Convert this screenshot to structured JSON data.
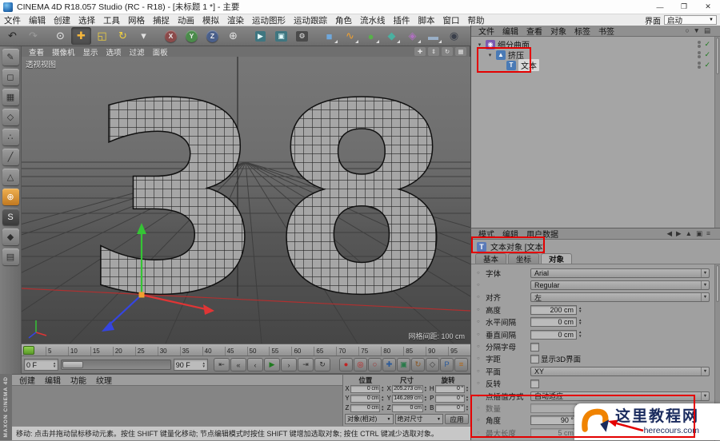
{
  "window": {
    "title": "CINEMA 4D R18.057 Studio (RC - R18) - [未标题 1 *] - 主要",
    "controls": [
      {
        "name": "minimize-button",
        "glyph": "—"
      },
      {
        "name": "maximize-button",
        "glyph": "❐"
      },
      {
        "name": "close-button",
        "glyph": "✕"
      }
    ]
  },
  "menu_bar": {
    "items": [
      "文件",
      "编辑",
      "创建",
      "选择",
      "工具",
      "网格",
      "捕捉",
      "动画",
      "模拟",
      "渲染",
      "运动图形",
      "运动跟踪",
      "角色",
      "流水线",
      "插件",
      "脚本",
      "窗口",
      "帮助"
    ],
    "interface_label": "界面",
    "interface_value": "启动"
  },
  "toolbar": {
    "icons": [
      {
        "name": "undo-icon",
        "glyph": "↶",
        "fg": "#222222"
      },
      {
        "name": "redo-icon",
        "glyph": "↷",
        "fg": "#9b9b9b"
      },
      {
        "sep": true
      },
      {
        "name": "live-selection-icon",
        "glyph": "⊙",
        "fg": "#e8e8e8"
      },
      {
        "name": "move-tool-icon",
        "glyph": "✚",
        "fg": "#f6b73c",
        "active": true
      },
      {
        "name": "scale-tool-icon",
        "glyph": "◱",
        "fg": "#f1d13f"
      },
      {
        "name": "rotate-tool-icon",
        "glyph": "↻",
        "fg": "#f1d13f"
      },
      {
        "name": "recent-tools-icon",
        "glyph": "▾",
        "fg": "#e0e0e0"
      },
      {
        "sep": true
      },
      {
        "name": "x-axis-lock",
        "glyph": "X",
        "circle": "#8a4a4a"
      },
      {
        "name": "y-axis-lock",
        "glyph": "Y",
        "circle": "#4a8a4a"
      },
      {
        "name": "z-axis-lock",
        "glyph": "Z",
        "circle": "#4a5f8a"
      },
      {
        "name": "coordinate-system-icon",
        "glyph": "⊕",
        "fg": "#e0e0e0"
      },
      {
        "sep": true
      },
      {
        "name": "render-view-icon",
        "glyph": "▶",
        "chip": "#3f7680",
        "fg": "#e8ffff"
      },
      {
        "name": "render-picture-viewer-icon",
        "glyph": "▣",
        "chip": "#3f7680",
        "fg": "#e8ffff"
      },
      {
        "name": "render-settings-icon",
        "glyph": "⚙",
        "chip": "#4a4a4a",
        "fg": "#e8e8e8"
      },
      {
        "sep": true
      },
      {
        "name": "primitive-cube-icon",
        "glyph": "■",
        "fg": "#6fa8dc",
        "corner": true
      },
      {
        "name": "spline-pen-icon",
        "glyph": "∿",
        "fg": "#f0a030",
        "corner": true
      },
      {
        "name": "subdivision-surface-icon",
        "glyph": "●",
        "fg": "#57b04a",
        "corner": true
      },
      {
        "name": "generator-icon",
        "glyph": "◆",
        "fg": "#4ab0a0",
        "corner": true
      },
      {
        "name": "deformer-icon",
        "glyph": "◈",
        "fg": "#b070c0",
        "corner": true
      },
      {
        "name": "environment-icon",
        "glyph": "▬",
        "fg": "#9ab0c8",
        "corner": true
      },
      {
        "name": "camera-icon",
        "glyph": "◉",
        "fg": "#3a3f4a"
      },
      {
        "name": "light-icon",
        "glyph": "☀",
        "fg": "#f1d13f"
      }
    ]
  },
  "left_toolbar": {
    "icons": [
      {
        "name": "make-editable-icon",
        "glyph": "✎"
      },
      {
        "name": "model-mode-icon",
        "glyph": "◻"
      },
      {
        "name": "texture-mode-icon",
        "glyph": "▦"
      },
      {
        "name": "workplane-mode-icon",
        "glyph": "◇"
      },
      {
        "name": "points-mode-icon",
        "glyph": "∴"
      },
      {
        "name": "edges-mode-icon",
        "glyph": "╱"
      },
      {
        "name": "polygons-mode-icon",
        "glyph": "△"
      },
      {
        "name": "enable-axis-icon",
        "glyph": "⊕",
        "style": "hl"
      },
      {
        "name": "snap-icon",
        "glyph": "S",
        "style": "dark"
      },
      {
        "name": "workplane-lock-icon",
        "glyph": "◆"
      },
      {
        "name": "viewport-filter-icon",
        "glyph": "▤"
      }
    ]
  },
  "viewport": {
    "menus": [
      "查看",
      "摄像机",
      "显示",
      "选项",
      "过滤",
      "面板"
    ],
    "corner_icons": [
      {
        "name": "pan-view-icon",
        "glyph": "✚"
      },
      {
        "name": "zoom-view-icon",
        "glyph": "⇕"
      },
      {
        "name": "orbit-view-icon",
        "glyph": "↻"
      },
      {
        "name": "toggle-view-icon",
        "glyph": "▦"
      }
    ],
    "view_label": "透视视图",
    "grid_label": "网格间距: 100 cm",
    "object_text": "38"
  },
  "timeline": {
    "ticks": [
      "0",
      "5",
      "10",
      "15",
      "20",
      "25",
      "30",
      "35",
      "40",
      "45",
      "50",
      "55",
      "60",
      "65",
      "70",
      "75",
      "80",
      "85",
      "90",
      "95"
    ],
    "current_frame": "0 F",
    "end_frame": "90 F"
  },
  "transport": {
    "buttons": [
      {
        "name": "goto-start-button",
        "glyph": "⇤"
      },
      {
        "name": "prev-key-button",
        "glyph": "«"
      },
      {
        "name": "prev-frame-button",
        "glyph": "‹"
      },
      {
        "name": "play-button",
        "glyph": "▶",
        "accent": "#1e7a1e"
      },
      {
        "name": "next-frame-button",
        "glyph": "›"
      },
      {
        "name": "goto-end-button",
        "glyph": "⇥"
      },
      {
        "name": "loop-button",
        "glyph": "↻"
      }
    ],
    "records": [
      {
        "name": "record-keyframe-button",
        "glyph": "●",
        "color": "#c22222"
      },
      {
        "name": "autokeying-button",
        "glyph": "◎",
        "color": "#c22222"
      },
      {
        "name": "keyframe-selection-button",
        "glyph": "○",
        "color": "#a33333"
      },
      {
        "name": "record-position-button",
        "glyph": "✚",
        "color": "#2a5a9a"
      },
      {
        "name": "record-scale-button",
        "glyph": "▣",
        "color": "#2a7a4a"
      },
      {
        "name": "record-rotation-button",
        "glyph": "↻",
        "color": "#8a5a2a"
      },
      {
        "name": "record-parameter-button",
        "glyph": "◇",
        "color": "#444444"
      },
      {
        "name": "record-pla-button",
        "glyph": "P",
        "color": "#2a5a9a"
      },
      {
        "name": "playback-settings-button",
        "glyph": "≡",
        "color": "#b06a20"
      }
    ]
  },
  "materials_panel": {
    "menus": [
      "创建",
      "编辑",
      "功能",
      "纹理"
    ]
  },
  "coordinates": {
    "groups": [
      {
        "title": "位置",
        "rows": [
          [
            "X",
            "0 cm"
          ],
          [
            "Y",
            "0 cm"
          ],
          [
            "Z",
            "0 cm"
          ]
        ]
      },
      {
        "title": "尺寸",
        "rows": [
          [
            "X",
            "205.273 cm"
          ],
          [
            "Y",
            "146.289 cm"
          ],
          [
            "Z",
            "0 cm"
          ]
        ]
      },
      {
        "title": "旋转",
        "rows": [
          [
            "H",
            "0 °"
          ],
          [
            "P",
            "0 °"
          ],
          [
            "B",
            "0 °"
          ]
        ]
      }
    ],
    "mode_value": "对象(相对)",
    "size_value": "绝对尺寸",
    "apply_label": "应用"
  },
  "object_manager": {
    "menus": [
      "文件",
      "编辑",
      "查看",
      "对象",
      "标签",
      "书签"
    ],
    "right_icons": [
      {
        "name": "search-icon",
        "glyph": "○"
      },
      {
        "name": "filter-icon",
        "glyph": "▼"
      },
      {
        "name": "browser-icon",
        "glyph": "▤"
      }
    ],
    "items": [
      {
        "key": "subdivision-surface",
        "label": "细分曲面",
        "depth": 0,
        "expand": "▾",
        "icon_glyph": "◉",
        "icon_color": "#7a5ab0"
      },
      {
        "key": "extrude",
        "label": "挤压",
        "depth": 1,
        "expand": "▾",
        "icon_glyph": "▲",
        "icon_color": "#4a7ab5"
      },
      {
        "key": "text-spline",
        "label": "文本",
        "depth": 2,
        "expand": "",
        "icon_glyph": "T",
        "icon_color": "#4a7ab5",
        "selected": true
      }
    ]
  },
  "attribute_manager": {
    "menus": [
      "模式",
      "编辑",
      "用户数据"
    ],
    "right_icons": [
      {
        "name": "nav-back-icon",
        "glyph": "◀"
      },
      {
        "name": "nav-forward-icon",
        "glyph": "▶"
      },
      {
        "name": "nav-up-icon",
        "glyph": "▲"
      },
      {
        "name": "lock-icon",
        "glyph": "▣"
      },
      {
        "name": "options-icon",
        "glyph": "≡"
      }
    ],
    "title": "文本对象 [文本]",
    "tabs": [
      "基本",
      "坐标",
      "对象"
    ],
    "active_tab": "对象",
    "fields": [
      {
        "key": "font",
        "label": "字体",
        "type": "select",
        "value": "Arial"
      },
      {
        "key": "font-style",
        "label": "",
        "type": "select",
        "value": "Regular"
      },
      {
        "key": "align",
        "label": "对齐",
        "type": "select",
        "value": "左"
      },
      {
        "key": "height",
        "label": "高度",
        "type": "stepper",
        "value": "200 cm"
      },
      {
        "key": "horizontal-spacing",
        "label": "水平间隔",
        "type": "stepper",
        "value": "0 cm"
      },
      {
        "key": "vertical-spac",
        "label": "垂直间隔",
        "type": "stepper",
        "value": "0 cm"
      },
      {
        "key": "separate-letters",
        "label": "分隔字母",
        "type": "checkbox",
        "value": ""
      },
      {
        "key": "kerning",
        "label": "字距",
        "type": "checklabel",
        "value": "显示3D界面"
      },
      {
        "key": "plane",
        "label": "平面",
        "type": "select",
        "value": "XY"
      },
      {
        "key": "reverse",
        "label": "反转",
        "type": "checkbox",
        "value": ""
      },
      {
        "key": "intermediate-points",
        "label": "点插值方式",
        "type": "select",
        "value": "自动适应"
      },
      {
        "key": "number",
        "label": "数量",
        "type": "stepper",
        "value": "",
        "disabled": true
      },
      {
        "key": "angle",
        "label": "角度",
        "type": "stepper",
        "value": "90 °"
      },
      {
        "key": "maximum-length",
        "label": "最大长度",
        "type": "stepper",
        "value": "5 cm",
        "disabled": true
      }
    ]
  },
  "status_bar": {
    "text": "移动: 点击并拖动鼠标移动元素。按住 SHIFT 键量化移动; 节点编辑模式时按住 SHIFT 键增加选取对象; 按住 CTRL 键减少选取对象。"
  },
  "branding": {
    "vertical_text": "MAXON CINEMA 4D"
  },
  "watermark": {
    "site_name": "这里教程网",
    "site_url": "herecours.com"
  },
  "annotations": {
    "color": "#e40000"
  }
}
